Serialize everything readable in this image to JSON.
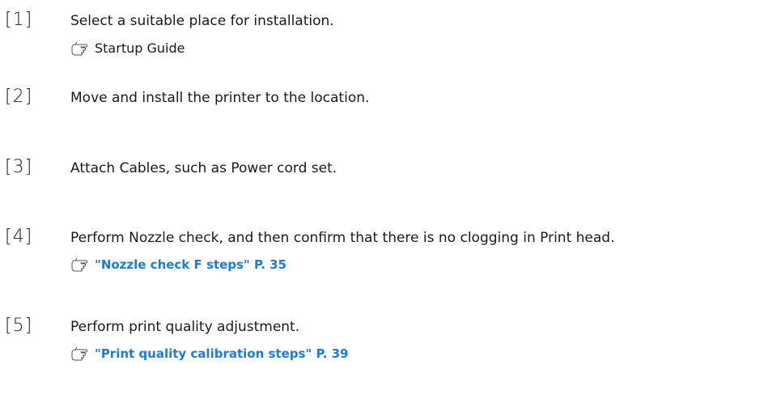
{
  "steps": [
    {
      "number": "[1]",
      "text": "Select a suitable place for installation.",
      "reference": {
        "label": "Startup Guide",
        "is_link": false,
        "icon": "pointing-hand-icon"
      }
    },
    {
      "number": "[2]",
      "text": "Move and install the printer to the location."
    },
    {
      "number": "[3]",
      "text": "Attach Cables, such as Power cord set."
    },
    {
      "number": "[4]",
      "text": "Perform Nozzle check, and then confirm that there is no clogging in Print head.",
      "reference": {
        "label": "\"Nozzle check F steps\" P. 35",
        "is_link": true,
        "icon": "pointing-hand-icon"
      }
    },
    {
      "number": "[5]",
      "text": "Perform print quality adjustment.",
      "reference": {
        "label": "\"Print quality calibration steps\" P. 39",
        "is_link": true,
        "icon": "pointing-hand-icon"
      }
    }
  ],
  "colors": {
    "link": "#1b7ce0",
    "text": "#1a1a1a"
  }
}
